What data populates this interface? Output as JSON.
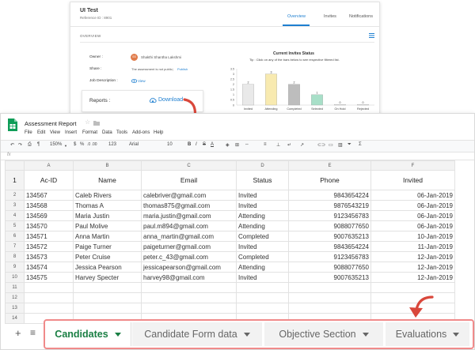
{
  "top_card": {
    "title": "UI Test",
    "reference": "Reference ID : 8901",
    "tabs": [
      "Overview",
      "Invites",
      "Notifications"
    ],
    "overview_heading": "OVERVIEW",
    "owner_label": "Owner :",
    "owner_initials": "SS",
    "owner_name": "Shakthi Shantha Lakshmi",
    "share_label": "Share :",
    "share_text": "The assessment is not public",
    "share_link": "Publish",
    "job_label": "Job Description :",
    "job_link": "View",
    "reports_label": "Reports :",
    "download_label": "Download"
  },
  "chart_data": {
    "type": "bar",
    "title": "Current Invites Status",
    "tip": "Tip : Click on any of the bars below to see respective filtered list.",
    "categories": [
      "Invited",
      "Attending",
      "Completed",
      "Selected",
      "On Hold",
      "Rejected"
    ],
    "values": [
      2,
      3,
      2,
      1,
      0,
      0
    ],
    "ylim": [
      0,
      3.5
    ],
    "yticks": [
      "3.5",
      "3",
      "2.5",
      "2",
      "1.5",
      "1",
      "0.5",
      "0"
    ],
    "colors": [
      "#e9e9e9",
      "#f8eab0",
      "#bdbdbd",
      "#a8dfc8",
      "#e9e9e9",
      "#e9e9e9"
    ]
  },
  "sheet": {
    "doc_title": "Assessment Report",
    "menu": [
      "File",
      "Edit",
      "View",
      "Insert",
      "Format",
      "Data",
      "Tools",
      "Add-ons",
      "Help"
    ],
    "toolbar": {
      "zoom": "150%",
      "currency": "$",
      "percent": "%",
      "decimals": ".0 .00",
      "format": "123",
      "font": "Arial",
      "size": "10"
    },
    "fx": "fx",
    "col_letters": [
      "A",
      "B",
      "C",
      "D",
      "E",
      "F"
    ],
    "headers": [
      "Ac-ID",
      "Name",
      "Email",
      "Status",
      "Phone",
      "Invited"
    ],
    "row_numbers": [
      "1",
      "2",
      "3",
      "4",
      "5",
      "6",
      "7",
      "8",
      "9",
      "10",
      "11",
      "12",
      "13",
      "14"
    ],
    "rows": [
      [
        "134567",
        "Caleb Rivers",
        "calebriver@gmail.com",
        "Invited",
        "9843654224",
        "06-Jan-2019"
      ],
      [
        "134568",
        "Thomas A",
        "thomas875@gmail.com",
        "Invited",
        "9876543219",
        "06-Jan-2019"
      ],
      [
        "134569",
        "Maria Justin",
        "maria.justin@gmail.com",
        "Attending",
        "9123456783",
        "06-Jan-2019"
      ],
      [
        "134570",
        "Paul Molive",
        "paul.m894@gmail.com",
        "Attending",
        "9088077650",
        "06-Jan-2019"
      ],
      [
        "134571",
        "Anna Martin",
        "anna_martin@gmail.com",
        "Completed",
        "9007635213",
        "10-Jan-2019"
      ],
      [
        "134572",
        "Paige Turner",
        "paigeturner@gmail.com",
        "Invited",
        "9843654224",
        "11-Jan-2019"
      ],
      [
        "134573",
        "Peter Cruise",
        "peter.c_43@gmail.com",
        "Completed",
        "9123456783",
        "12-Jan-2019"
      ],
      [
        "134574",
        "Jessica Pearson",
        "jessicapearson@gmail.com",
        "Attending",
        "9088077650",
        "12-Jan-2019"
      ],
      [
        "134575",
        "Harvey Specter",
        "harvey98@gmail.com",
        "Invited",
        "9007635213",
        "12-Jan-2019"
      ]
    ],
    "sheet_tabs": [
      "Candidates",
      "Candidate Form data",
      "Objective Section",
      "Evaluations"
    ],
    "colors": {
      "sheets_green": "#0f9d58",
      "active_tab": "#1a7f44",
      "highlight": "#f08a8a",
      "arrow": "#d9473b"
    }
  }
}
